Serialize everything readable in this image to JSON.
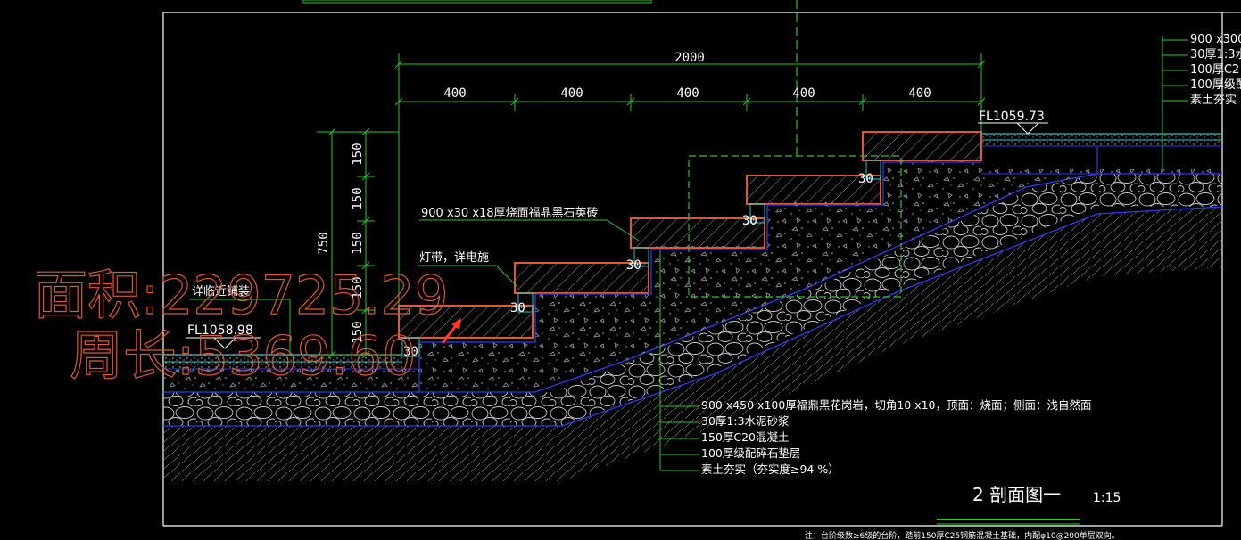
{
  "dimensions": {
    "total_width": "2000",
    "segments": [
      "400",
      "400",
      "400",
      "400",
      "400"
    ],
    "total_height": "750",
    "risers": [
      "150",
      "150",
      "150",
      "150",
      "150"
    ],
    "joint_width": "30"
  },
  "elevations": {
    "upper": "FL1059.73",
    "lower": "FL1058.98"
  },
  "annotations": {
    "paver": "900 x30 x18厚烧面福鼎黑石英砖",
    "light_strip": "灯带，详电施",
    "adjacent_paving": "详临近铺装"
  },
  "layer_callouts": [
    "900 x450 x100厚福鼎黑花岗岩，切角10 x10，顶面：烧面；侧面：浅自然面",
    "30厚1:3水泥砂浆",
    "150厚C20混凝土",
    "100厚级配碎石垫层",
    "素土夯实（夯实度≥94 %）"
  ],
  "right_callouts": [
    "900 x300",
    "30厚1:3水",
    "100厚C2",
    "100厚级配",
    "素土夯实（"
  ],
  "section_title": "2 剖面图一",
  "scale": "1:15",
  "footnote": "注：台阶级数≥6级的台阶，踏前150厚C25钢筋混凝土基础，内配φ10@200单层双向。",
  "watermark": {
    "area": "面积:229725.29",
    "perimeter": "周长:5369.60"
  },
  "colors": {
    "background": "#000000",
    "frame": "#ffffff",
    "stone_outline": "#e0582e",
    "dimension": "#29c729",
    "layer_line": "#2a3ef5",
    "watermark": "#e0582e"
  }
}
